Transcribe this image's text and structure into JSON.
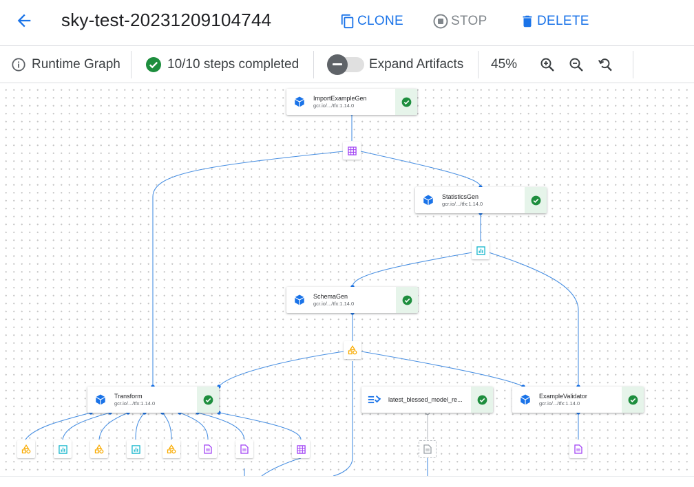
{
  "header": {
    "title": "sky-test-20231209104744",
    "clone_label": "CLONE",
    "stop_label": "STOP",
    "delete_label": "DELETE"
  },
  "toolbar": {
    "runtime_graph_label": "Runtime Graph",
    "steps_status": "10/10 steps completed",
    "expand_artifacts_label": "Expand Artifacts",
    "expand_artifacts_on": false,
    "zoom_level": "45%"
  },
  "colors": {
    "accent": "#1a73e8",
    "success": "#1e8e3e",
    "success_bg": "#e6f4ea",
    "edge": "#4a90e2",
    "artifact_examples": "#a142f4",
    "artifact_statistics": "#12b5cb",
    "artifact_schema": "#f9ab00"
  },
  "graph": {
    "nodes": [
      {
        "id": "import",
        "name": "ImportExampleGen",
        "image": "gcr.io/.../tfx:1.14.0",
        "icon": "component-cube-icon",
        "status": "success"
      },
      {
        "id": "stats",
        "name": "StatisticsGen",
        "image": "gcr.io/.../tfx:1.14.0",
        "icon": "component-cube-icon",
        "status": "success"
      },
      {
        "id": "schema",
        "name": "SchemaGen",
        "image": "gcr.io/.../tfx:1.14.0",
        "icon": "component-cube-icon",
        "status": "success"
      },
      {
        "id": "transform",
        "name": "Transform",
        "image": "gcr.io/.../tfx:1.14.0",
        "icon": "component-cube-icon",
        "status": "success"
      },
      {
        "id": "resolver",
        "name": "latest_blessed_model_re...",
        "image": "",
        "icon": "resolver-icon",
        "status": "success"
      },
      {
        "id": "validator",
        "name": "ExampleValidator",
        "image": "gcr.io/.../tfx:1.14.0",
        "icon": "component-cube-icon",
        "status": "success"
      }
    ],
    "artifacts": [
      {
        "type": "examples",
        "icon": "examples-artifact-icon"
      },
      {
        "type": "statistics",
        "icon": "statistics-artifact-icon"
      },
      {
        "type": "schema",
        "icon": "schema-artifact-icon"
      },
      {
        "type": "schema",
        "icon": "schema-artifact-icon"
      },
      {
        "type": "statistics",
        "icon": "statistics-artifact-icon"
      },
      {
        "type": "schema",
        "icon": "schema-artifact-icon"
      },
      {
        "type": "statistics",
        "icon": "statistics-artifact-icon"
      },
      {
        "type": "schema",
        "icon": "schema-artifact-icon"
      },
      {
        "type": "file",
        "icon": "file-artifact-icon"
      },
      {
        "type": "file",
        "icon": "file-artifact-icon"
      },
      {
        "type": "examples",
        "icon": "examples-artifact-icon"
      },
      {
        "type": "file",
        "icon": "file-artifact-icon",
        "state": "pending"
      },
      {
        "type": "file",
        "icon": "file-artifact-icon"
      }
    ]
  }
}
